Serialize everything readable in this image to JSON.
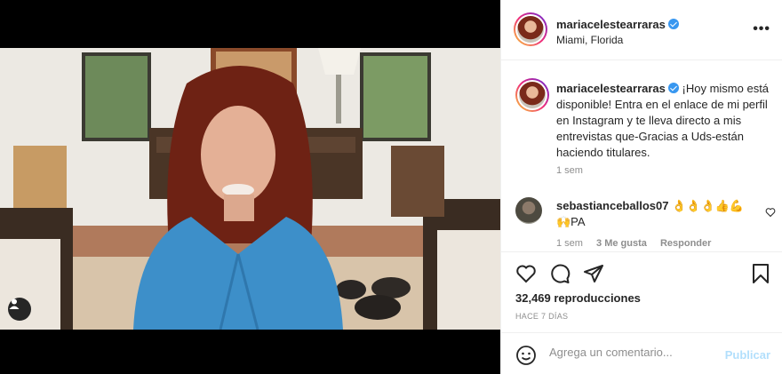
{
  "post": {
    "username": "mariacelestearraras",
    "location": "Miami, Florida",
    "verified": true
  },
  "caption": {
    "username": "mariacelestearraras",
    "text": "¡Hoy mismo está disponible! Entra en el enlace de mi perfil en Instagram y te lleva directo a mis entrevistas que-Gracias a Uds-están haciendo titulares.",
    "time": "1 sem"
  },
  "comment": {
    "username": "sebastianceballos07",
    "text": "👌👌👌👍💪🙌PA",
    "time": "1 sem",
    "likes": "3 Me gusta",
    "reply": "Responder"
  },
  "stats": {
    "views": "32,469 reproducciones",
    "date": "HACE 7 DÍAS"
  },
  "comment_box": {
    "placeholder": "Agrega un comentario...",
    "publish": "Publicar"
  },
  "icons": {
    "more": "more-options-icon",
    "like": "heart-icon",
    "comment": "comment-icon",
    "share": "share-icon",
    "save": "bookmark-icon",
    "emoji": "emoji-icon",
    "user_tag": "user-tag-icon",
    "sound": "sound-icon"
  },
  "colors": {
    "verified": "#3897f0",
    "publish_disabled": "#b2dffc",
    "secondary_text": "#8e8e8e"
  }
}
